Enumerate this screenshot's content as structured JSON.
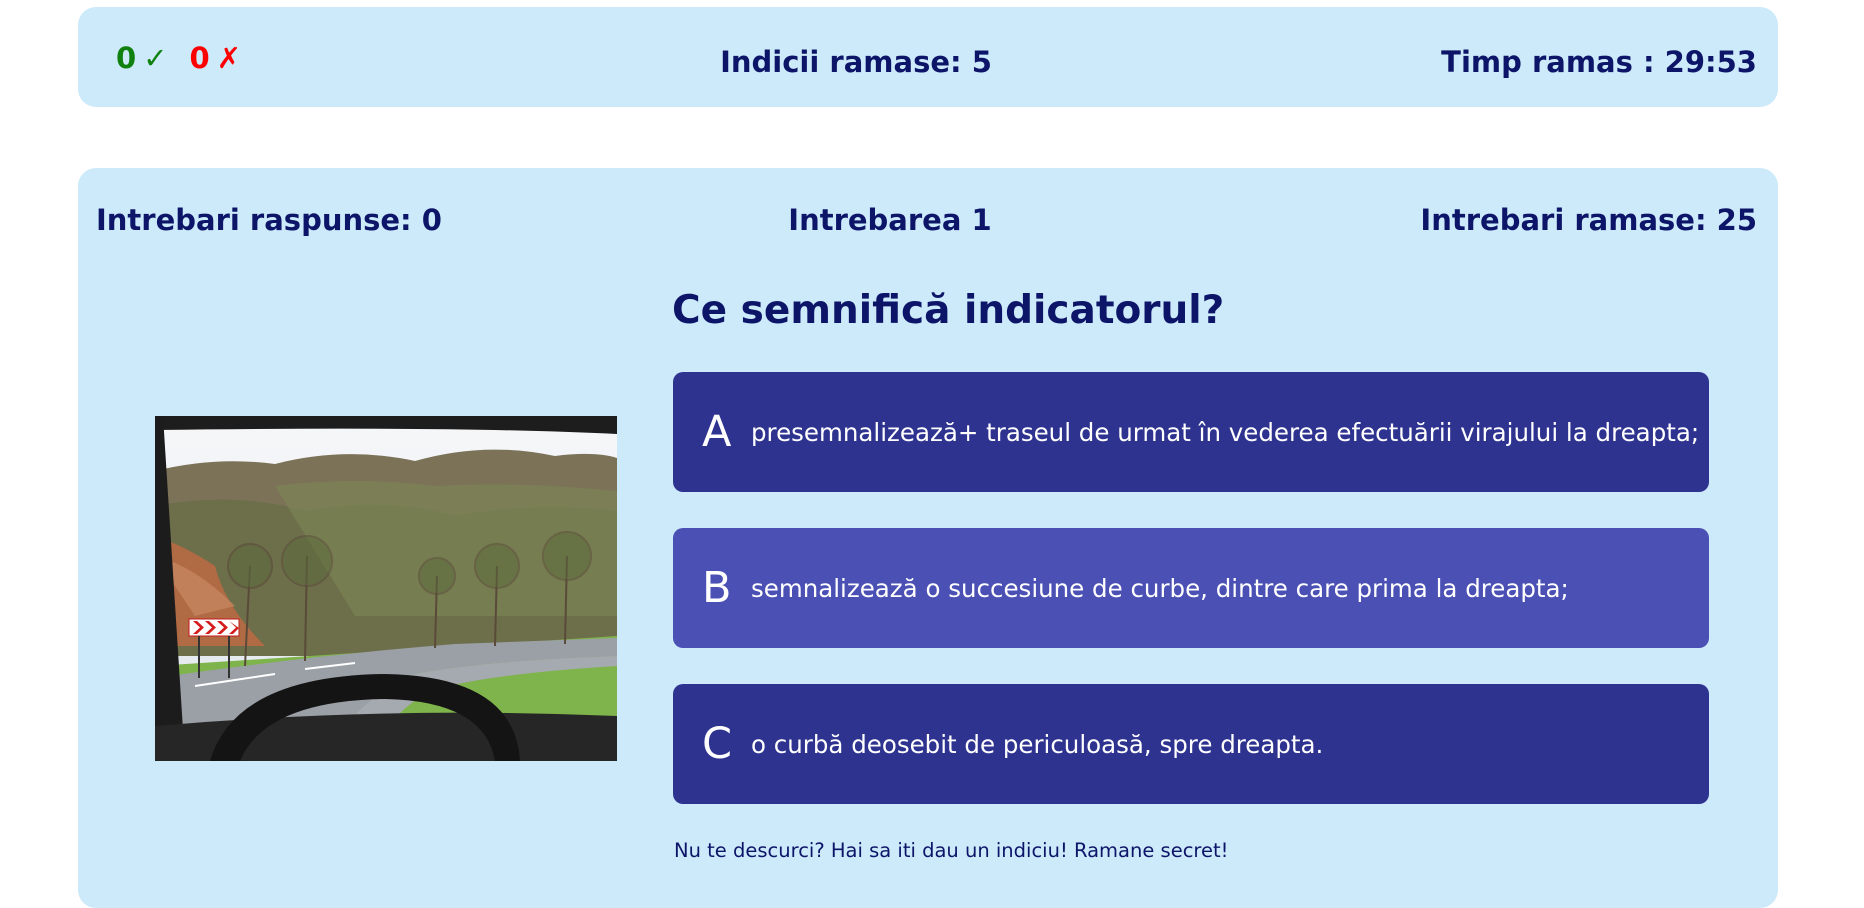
{
  "header": {
    "correct_count": "0",
    "correct_symbol": "✓",
    "wrong_count": "0",
    "wrong_symbol": "✗",
    "hints_text": "Indicii ramase: 5",
    "timer_text": "Timp ramas : 29:53"
  },
  "quiz": {
    "answered_text": "Intrebari raspunse: 0",
    "question_number_text": "Intrebarea 1",
    "remaining_text": "Intrebari ramase: 25",
    "question": "Ce semnifică indicatorul?",
    "answers": [
      {
        "letter": "A",
        "text": "presemnalizează+ traseul de urmat în vederea efectuării virajului la dreapta;"
      },
      {
        "letter": "B",
        "text": "semnalizează o succesiune de curbe, dintre care prima la dreapta;"
      },
      {
        "letter": "C",
        "text": "o curbă deosebit de periculoasă, spre dreapta."
      }
    ],
    "hint_link": "Nu te descurci? Hai sa iti dau un indiciu! Ramane secret!"
  },
  "colors": {
    "panel_bg": "#cdeafa",
    "title_text": "#0d1569",
    "correct": "#10800f",
    "wrong": "#ff0000",
    "answer_dark": "#2e3390",
    "answer_light": "#4b50b4"
  },
  "image": {
    "subject": "windshield-view-road-with-chevron-sign"
  }
}
